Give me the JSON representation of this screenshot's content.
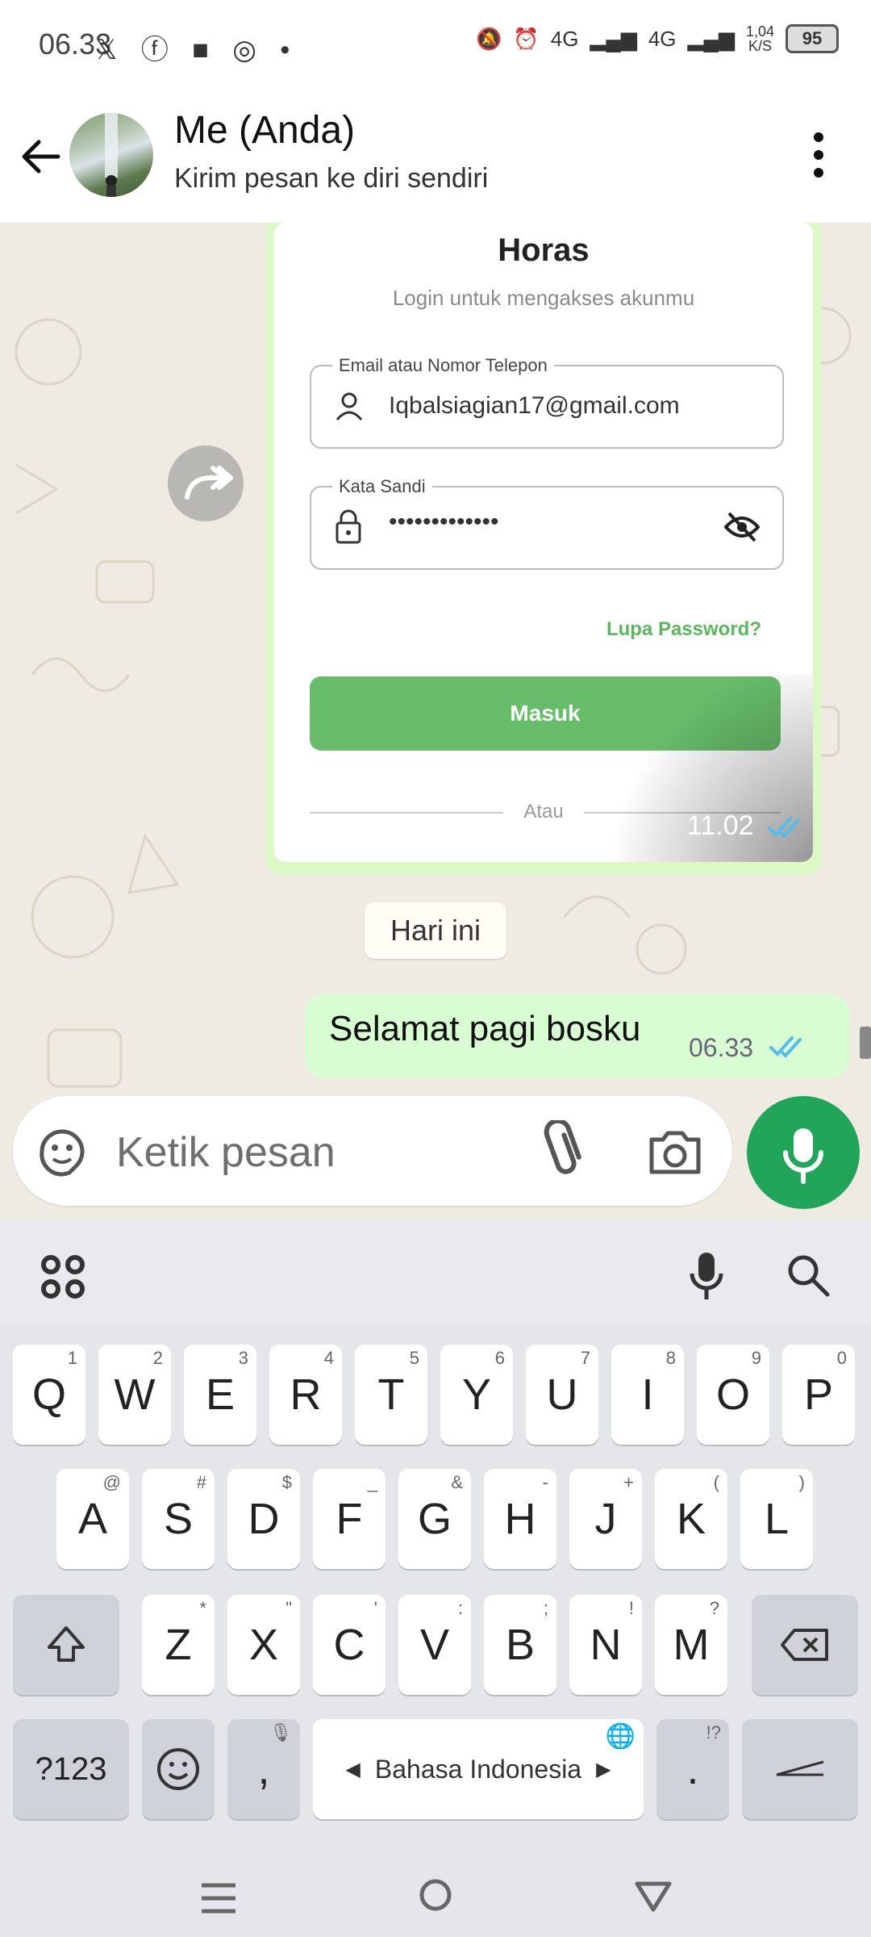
{
  "status_bar": {
    "time": "06.33",
    "net1": "4G",
    "net2": "4G",
    "speed_value": "1,04",
    "speed_unit": "K/S",
    "battery": "95"
  },
  "header": {
    "title": "Me (Anda)",
    "subtitle": "Kirim pesan ke diri sendiri"
  },
  "image_message": {
    "app_title": "Horas",
    "app_subtitle": "Login untuk mengakses akunmu",
    "email_label": "Email atau Nomor Telepon",
    "email_value": "Iqbalsiagian17@gmail.com",
    "password_label": "Kata Sandi",
    "password_value": "•••••••••••••",
    "forgot_label": "Lupa Password?",
    "login_button": "Masuk",
    "divider_text": "Atau",
    "time": "11.02"
  },
  "date_chip": "Hari ini",
  "text_message": {
    "text": "Selamat pagi bosku",
    "time": "06.33"
  },
  "composer": {
    "placeholder": "Ketik pesan"
  },
  "keyboard": {
    "row1": [
      {
        "k": "Q",
        "h": "1"
      },
      {
        "k": "W",
        "h": "2"
      },
      {
        "k": "E",
        "h": "3"
      },
      {
        "k": "R",
        "h": "4"
      },
      {
        "k": "T",
        "h": "5"
      },
      {
        "k": "Y",
        "h": "6"
      },
      {
        "k": "U",
        "h": "7"
      },
      {
        "k": "I",
        "h": "8"
      },
      {
        "k": "O",
        "h": "9"
      },
      {
        "k": "P",
        "h": "0"
      }
    ],
    "row2": [
      {
        "k": "A",
        "h": "@"
      },
      {
        "k": "S",
        "h": "#"
      },
      {
        "k": "D",
        "h": "$"
      },
      {
        "k": "F",
        "h": "_"
      },
      {
        "k": "G",
        "h": "&"
      },
      {
        "k": "H",
        "h": "-"
      },
      {
        "k": "J",
        "h": "+"
      },
      {
        "k": "K",
        "h": "("
      },
      {
        "k": "L",
        "h": ")"
      }
    ],
    "row3": [
      {
        "k": "Z",
        "h": "*"
      },
      {
        "k": "X",
        "h": "\""
      },
      {
        "k": "C",
        "h": "'"
      },
      {
        "k": "V",
        "h": ":"
      },
      {
        "k": "B",
        "h": ";"
      },
      {
        "k": "N",
        "h": "!"
      },
      {
        "k": "M",
        "h": "?"
      }
    ],
    "symbols_key": "?123",
    "comma_key": ",",
    "space_label": "Bahasa Indonesia",
    "period_key": ".",
    "period_hint": "!?"
  },
  "colors": {
    "accent_green": "#21a558",
    "bubble_green": "#d9fdd3",
    "tick_blue": "#53bdeb"
  }
}
